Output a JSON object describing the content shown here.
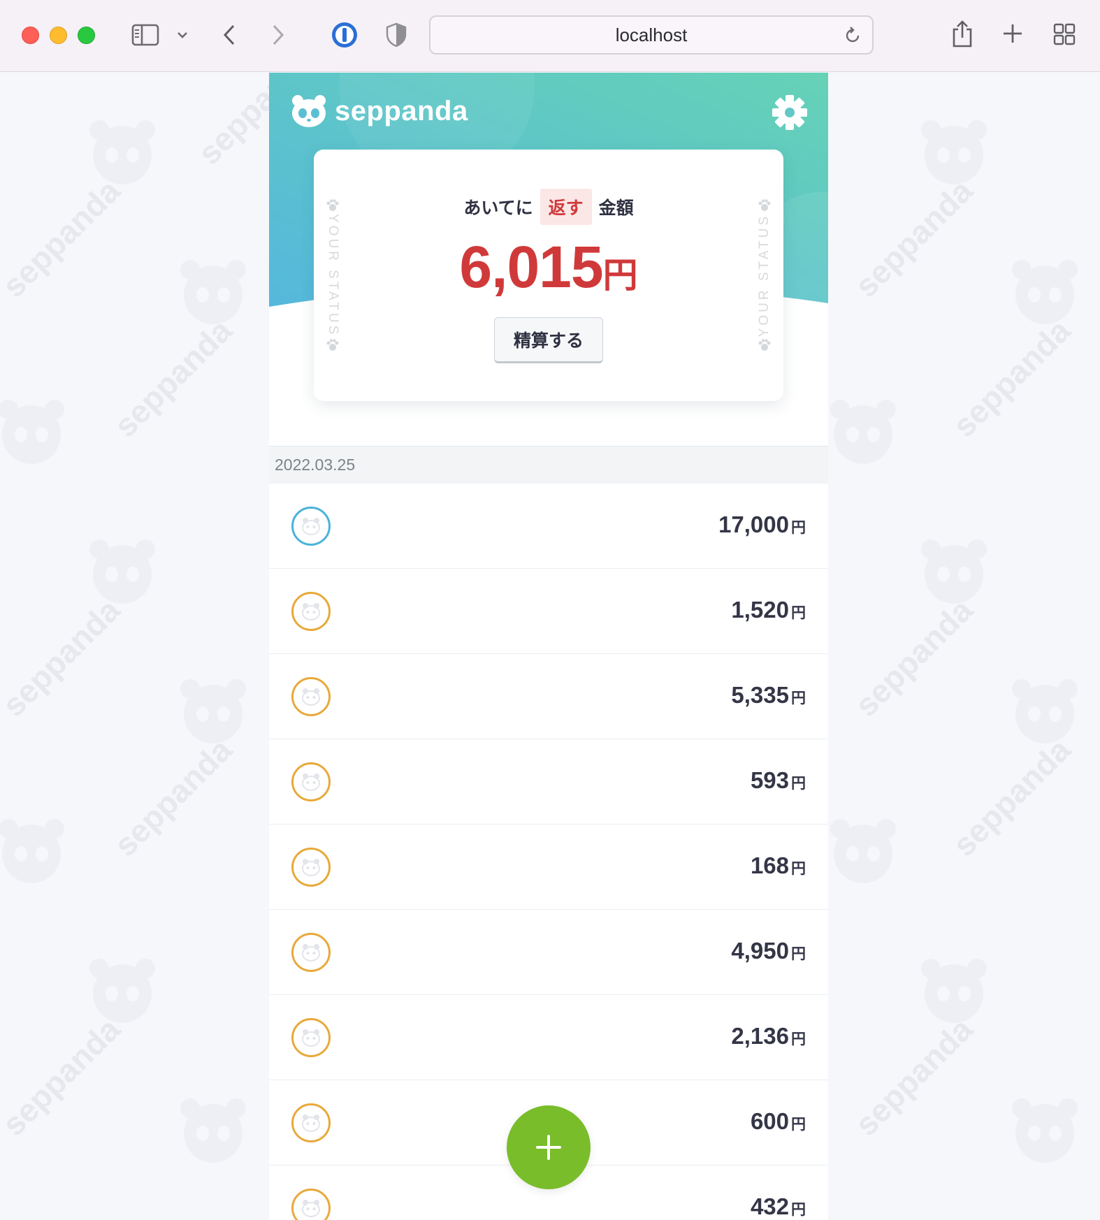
{
  "browser": {
    "url": "localhost"
  },
  "app": {
    "name": "seppanda"
  },
  "status_card": {
    "title_prefix": "あいてに",
    "title_highlight": "返す",
    "title_suffix": "金額",
    "amount": "6,015",
    "amount_unit": "円",
    "settle_label": "精算する",
    "side_label": "YOUR STATUS"
  },
  "watermark": {
    "text": "seppanda"
  },
  "transactions": {
    "date": "2022.03.25",
    "unit": "円",
    "items": [
      {
        "amount": "17,000",
        "avatar_color": "#4ab3d9"
      },
      {
        "amount": "1,520",
        "avatar_color": "#e8a93a"
      },
      {
        "amount": "5,335",
        "avatar_color": "#e8a93a"
      },
      {
        "amount": "593",
        "avatar_color": "#e8a93a"
      },
      {
        "amount": "168",
        "avatar_color": "#e8a93a"
      },
      {
        "amount": "4,950",
        "avatar_color": "#e8a93a"
      },
      {
        "amount": "2,136",
        "avatar_color": "#e8a93a"
      },
      {
        "amount": "600",
        "avatar_color": "#e8a93a"
      },
      {
        "amount": "432",
        "avatar_color": "#e8a93a"
      }
    ]
  },
  "colors": {
    "accent_red": "#d0393a",
    "fab_green": "#79bd2a",
    "hero_gradient_start": "#5bbcd9",
    "hero_gradient_end": "#66d0b8"
  },
  "icons": {
    "settings": "gear-icon",
    "add": "plus-icon",
    "avatar": "panda-icon"
  }
}
